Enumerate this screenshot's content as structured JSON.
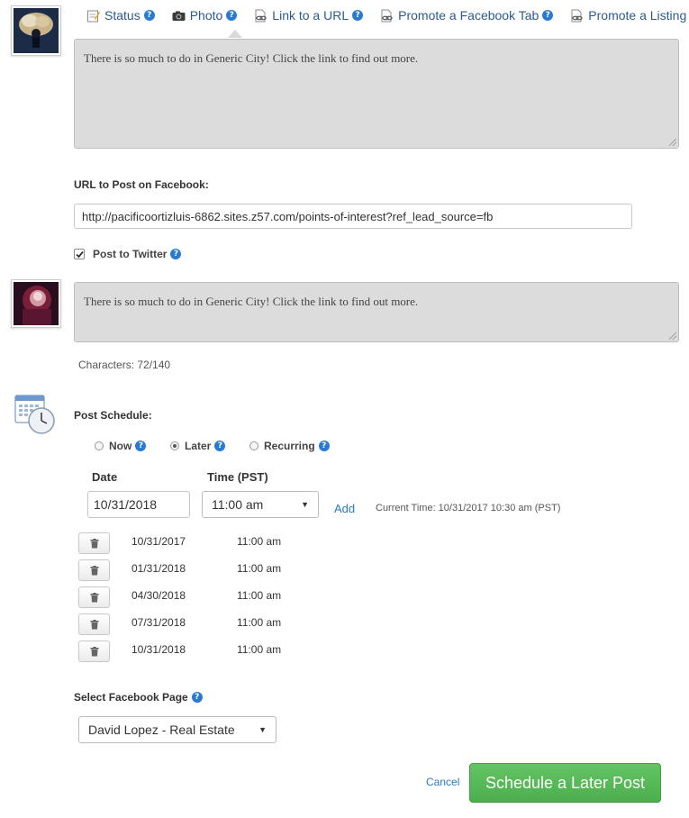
{
  "tabs": [
    {
      "label": "Status",
      "icon": "notepad-icon"
    },
    {
      "label": "Photo",
      "icon": "camera-icon"
    },
    {
      "label": "Link to a URL",
      "icon": "link-document-icon"
    },
    {
      "label": "Promote a Facebook Tab",
      "icon": "link-document-icon"
    },
    {
      "label": "Promote a Listing",
      "icon": "link-document-icon"
    }
  ],
  "facebook_post": {
    "message": "There is so much to do in Generic City! Click the link to find out more."
  },
  "url_field": {
    "label": "URL to Post on Facebook:",
    "value": "http://pacificoortizluis-6862.sites.z57.com/points-of-interest?ref_lead_source=fb"
  },
  "twitter": {
    "checkbox_label": "Post to Twitter",
    "checked": true,
    "message": "There is so much to do in Generic City! Click the link to find out more.",
    "characters": "Characters: 72/140"
  },
  "schedule": {
    "label": "Post Schedule:",
    "options": [
      {
        "label": "Now",
        "selected": false
      },
      {
        "label": "Later",
        "selected": true
      },
      {
        "label": "Recurring",
        "selected": false
      }
    ],
    "date_header": "Date",
    "time_header": "Time (PST)",
    "date_value": "10/31/2018",
    "time_value": "11:00 am",
    "add_label": "Add",
    "current_time": "Current Time: 10/31/2017 10:30 am (PST)",
    "entries": [
      {
        "date": "10/31/2017",
        "time": "11:00 am"
      },
      {
        "date": "01/31/2018",
        "time": "11:00 am"
      },
      {
        "date": "04/30/2018",
        "time": "11:00 am"
      },
      {
        "date": "07/31/2018",
        "time": "11:00 am"
      },
      {
        "date": "10/31/2018",
        "time": "11:00 am"
      }
    ]
  },
  "page_select": {
    "label": "Select Facebook Page",
    "value": "David Lopez - Real Estate"
  },
  "actions": {
    "cancel": "Cancel",
    "submit": "Schedule a Later Post"
  },
  "colors": {
    "link_blue": "#2b5a8e",
    "help_blue": "#2a7bd0",
    "submit_green": "#5cb85c"
  }
}
